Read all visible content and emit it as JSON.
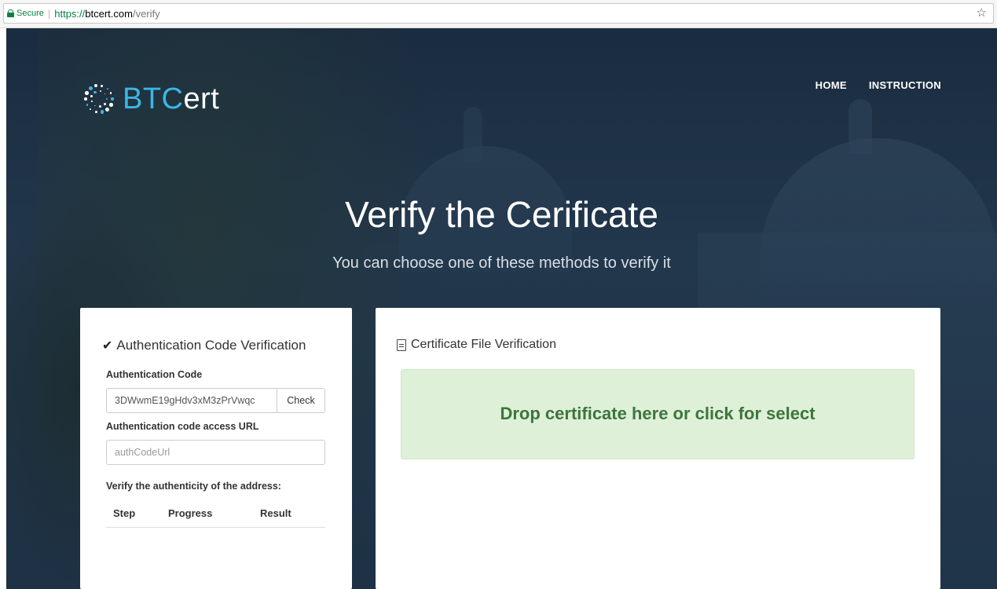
{
  "browser": {
    "secure_label": "Secure",
    "url_scheme": "https://",
    "url_host": "btcert.com",
    "url_path": "/verify",
    "star_glyph": "☆"
  },
  "logo": {
    "text_main": "BTC",
    "text_rest": "ert",
    "accent_color": "#3ab7e6"
  },
  "nav": {
    "items": [
      {
        "label": "HOME"
      },
      {
        "label": "INSTRUCTION"
      }
    ]
  },
  "hero": {
    "title": "Verify the Cerificate",
    "subtitle": "You can choose one of these methods to verify it"
  },
  "auth_card": {
    "heading": "Authentication Code Verification",
    "code_label": "Authentication Code",
    "code_value": "3DWwmE19gHdv3xM3zPrVwqc",
    "check_button": "Check",
    "url_label": "Authentication code access URL",
    "url_placeholder": "authCodeUrl",
    "verify_label": "Verify the authenticity of the address:",
    "table_headers": [
      "Step",
      "Progress",
      "Result"
    ]
  },
  "file_card": {
    "heading": "Certificate File Verification",
    "dropzone_text": "Drop certificate here or click for select",
    "dropzone_bg": "#dff0d8",
    "dropzone_text_color": "#3c763d"
  }
}
